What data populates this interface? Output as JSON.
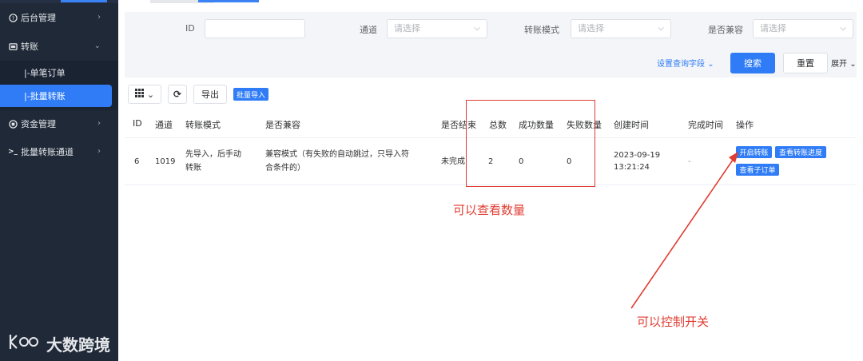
{
  "sidebar": {
    "items": [
      {
        "label": "后台管理",
        "icon": "question-circle-icon"
      },
      {
        "label": "转账",
        "icon": "transfer-icon"
      },
      {
        "label": "|-单笔订单"
      },
      {
        "label": "|-批量转账"
      },
      {
        "label": "资金管理",
        "icon": "coin-icon"
      },
      {
        "label": "批量转账通道",
        "icon": "terminal-icon"
      }
    ],
    "active_color": "#2f7cf6"
  },
  "watermark": {
    "logo": "K",
    "logo_suffix": "O",
    "text": "大数跨境"
  },
  "filters": {
    "id_label": "ID",
    "channel_label": "通道",
    "channel_placeholder": "请选择",
    "mode_label": "转账模式",
    "mode_placeholder": "请选择",
    "compat_label": "是否兼容",
    "compat_placeholder": "请选择",
    "advanced_label": "设置查询字段",
    "search_label": "搜索",
    "reset_label": "重置",
    "expand_label": "展开"
  },
  "toolbar": {
    "export_label": "导出",
    "batch_import_label": "批量导入"
  },
  "table": {
    "headers": [
      "ID",
      "通道",
      "转账模式",
      "是否兼容",
      "是否结束",
      "总数",
      "成功数量",
      "失败数量",
      "创建时间",
      "完成时间",
      "操作"
    ],
    "rows": [
      {
        "id": "6",
        "channel": "1019",
        "mode_line1": "先导入，后手动",
        "mode_line2": "转账",
        "compat_line1": "兼容模式（有失败的自动跳过，只导入符",
        "compat_line2": "合条件的）",
        "ended": "未完成",
        "total": "2",
        "success": "0",
        "failed": "0",
        "created_date": "2023-09-19",
        "created_time": "13:21:24",
        "finished": "-",
        "actions": [
          "开启转账",
          "查看转账进度",
          "查看子订单"
        ]
      }
    ]
  },
  "annotations": {
    "count_note": "可以查看数量",
    "switch_note": "可以控制开关",
    "color": "#e03c31"
  }
}
